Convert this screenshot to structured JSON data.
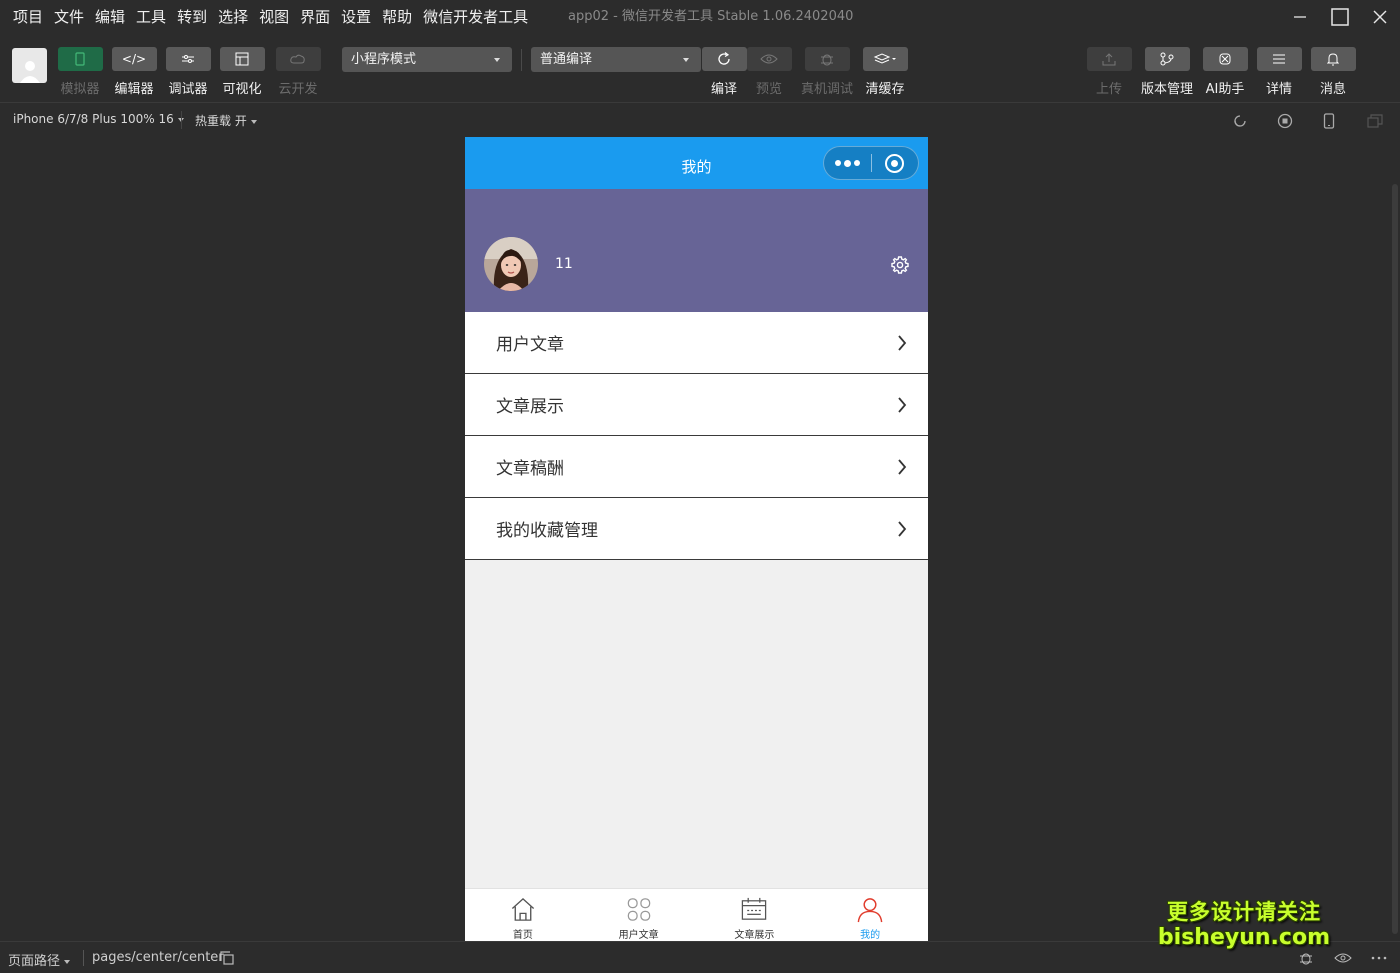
{
  "menubar": {
    "items": [
      "项目",
      "文件",
      "编辑",
      "工具",
      "转到",
      "选择",
      "视图",
      "界面",
      "设置",
      "帮助",
      "微信开发者工具"
    ],
    "window_title": "app02 - 微信开发者工具 Stable 1.06.2402040"
  },
  "toolbar": {
    "simulator": "模拟器",
    "editor": "编辑器",
    "debugger": "调试器",
    "visual": "可视化",
    "cloud": "云开发",
    "mode_select": "小程序模式",
    "compile_select": "普通编译",
    "compile": "编译",
    "preview": "预览",
    "real_debug": "真机调试",
    "clear_cache": "清缓存",
    "upload": "上传",
    "version": "版本管理",
    "ai": "AI助手",
    "details": "详情",
    "messages": "消息"
  },
  "devicebar": {
    "device": "iPhone 6/7/8 Plus 100% 16",
    "hot_reload": "热重载 开"
  },
  "phone": {
    "nav_title": "我的",
    "profile": {
      "name": "11"
    },
    "menu": [
      {
        "label": "用户文章"
      },
      {
        "label": "文章展示"
      },
      {
        "label": "文章稿酬"
      },
      {
        "label": "我的收藏管理"
      }
    ],
    "tabs": [
      {
        "label": "首页",
        "icon": "home-icon"
      },
      {
        "label": "用户文章",
        "icon": "grid-icon"
      },
      {
        "label": "文章展示",
        "icon": "calendar-icon"
      },
      {
        "label": "我的",
        "icon": "user-icon"
      }
    ],
    "colors": {
      "navbar": "#1a9bef",
      "profile_bg": "#676496",
      "active_tab": "#e13d2e"
    }
  },
  "statusbar": {
    "path_label": "页面路径",
    "path": "pages/center/center"
  },
  "watermark": {
    "line1": "更多设计请关注",
    "line2": "bisheyun.com"
  }
}
